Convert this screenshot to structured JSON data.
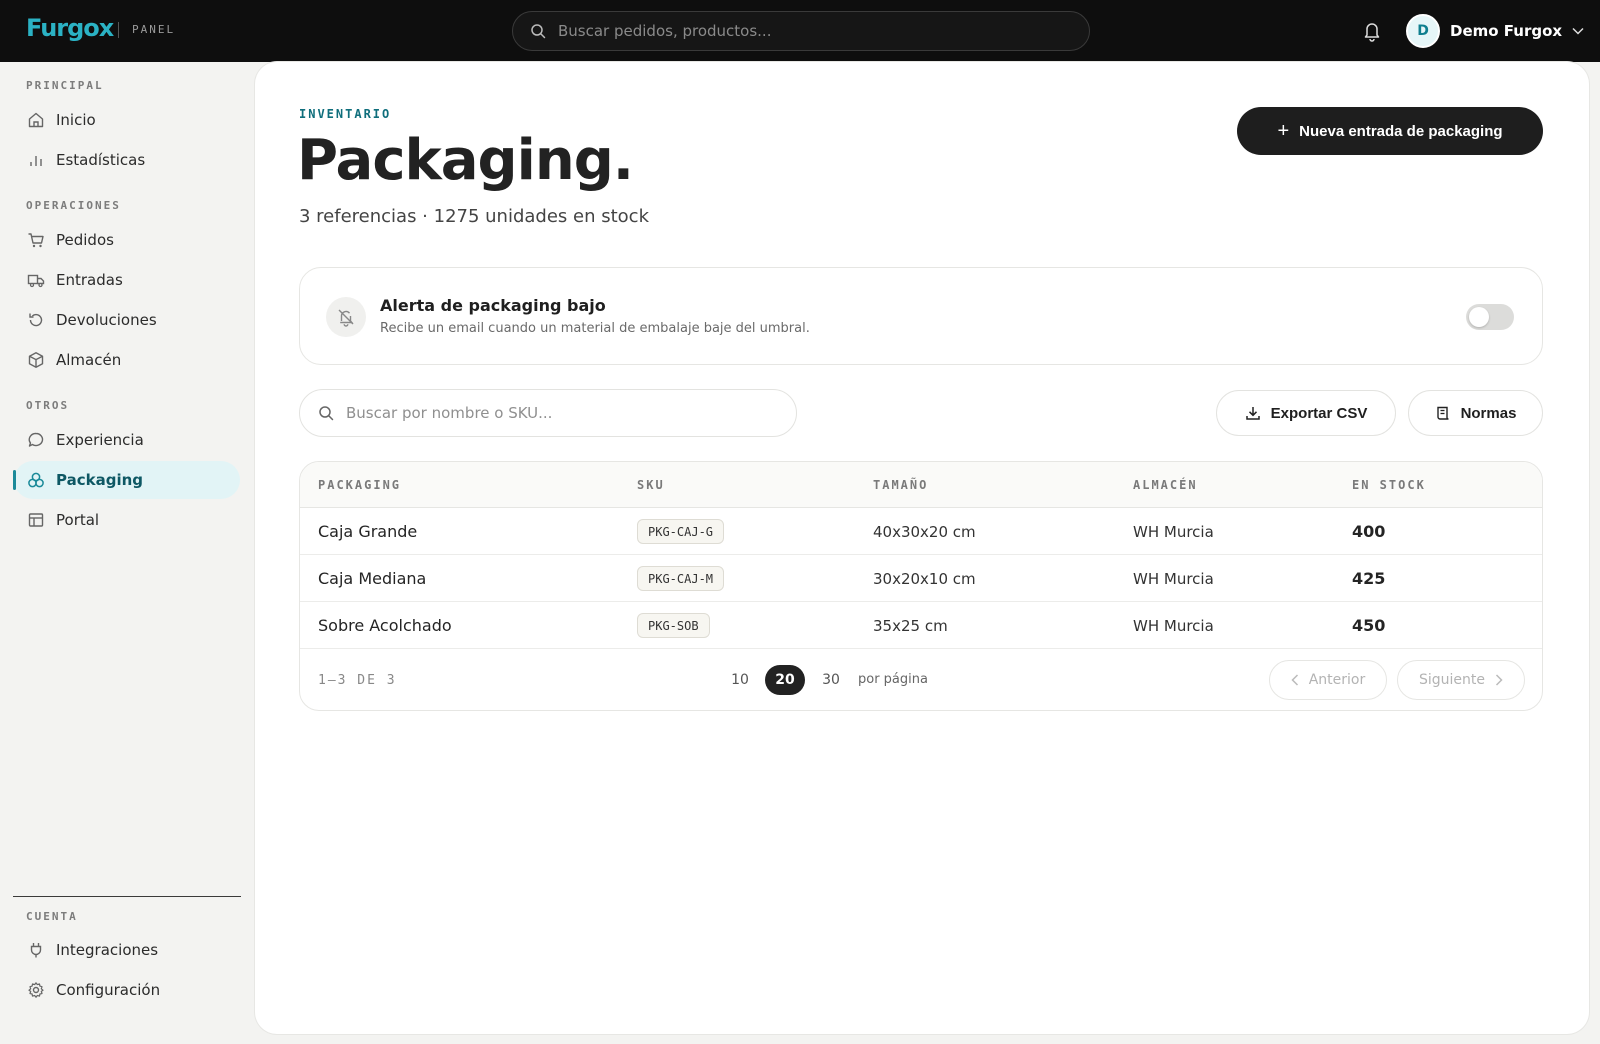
{
  "topbar": {
    "brand": "Furgox",
    "panel_label": "PANEL",
    "search_placeholder": "Buscar pedidos, productos...",
    "user_initial": "D",
    "user_name": "Demo Furgox"
  },
  "sidebar": {
    "sections": {
      "principal": "PRINCIPAL",
      "operaciones": "OPERACIONES",
      "otros": "OTROS",
      "cuenta": "CUENTA"
    },
    "items": {
      "inicio": "Inicio",
      "estadisticas": "Estadísticas",
      "pedidos": "Pedidos",
      "entradas": "Entradas",
      "devoluciones": "Devoluciones",
      "almacen": "Almacén",
      "experiencia": "Experiencia",
      "packaging": "Packaging",
      "portal": "Portal",
      "integraciones": "Integraciones",
      "configuracion": "Configuración"
    },
    "active": "packaging"
  },
  "page": {
    "eyebrow": "INVENTARIO",
    "title": "Packaging.",
    "subtitle": "3 referencias · 1275 unidades en stock",
    "new_button": "Nueva entrada de packaging"
  },
  "alert": {
    "title": "Alerta de packaging bajo",
    "description": "Recibe un email cuando un material de embalaje baje del umbral.",
    "enabled": false
  },
  "toolbar": {
    "search_placeholder": "Buscar por nombre o SKU...",
    "export_label": "Exportar CSV",
    "rules_label": "Normas"
  },
  "table": {
    "headers": {
      "packaging": "PACKAGING",
      "sku": "SKU",
      "size": "TAMAÑO",
      "warehouse": "ALMACÉN",
      "stock": "EN STOCK"
    },
    "rows": [
      {
        "name": "Caja Grande",
        "sku": "PKG-CAJ-G",
        "size": "40x30x20 cm",
        "warehouse": "WH Murcia",
        "stock": "400"
      },
      {
        "name": "Caja Mediana",
        "sku": "PKG-CAJ-M",
        "size": "30x20x10 cm",
        "warehouse": "WH Murcia",
        "stock": "425"
      },
      {
        "name": "Sobre Acolchado",
        "sku": "PKG-SOB",
        "size": "35x25 cm",
        "warehouse": "WH Murcia",
        "stock": "450"
      }
    ],
    "range_text": "1–3 DE 3",
    "page_sizes": [
      "10",
      "20",
      "30"
    ],
    "page_size_selected": "20",
    "per_page_label": "por página",
    "prev_label": "Anterior",
    "next_label": "Siguiente"
  },
  "colors": {
    "accent": "#1a8a99",
    "brand": "#2bb2c4",
    "topbar_bg": "#0e0e0e",
    "primary_button": "#1e1e1e"
  }
}
